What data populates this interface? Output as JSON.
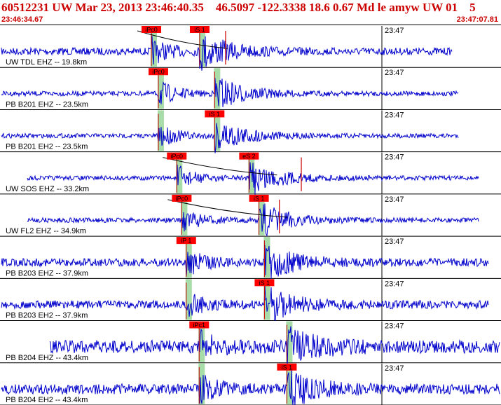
{
  "header": {
    "title": "60512231 UW Mar 23, 2013 23:46:40.35    46.5097 -122.3338 18.6 0.67 Md le amyw UW 01    5",
    "start_time": "23:46:34.67",
    "end_time": "23:47:07.81"
  },
  "time_tick_label": "23:47",
  "colors": {
    "trace": "#0000cc",
    "pick": "#ff0000",
    "window": "#a8dca8",
    "header_text": "#cc0000",
    "theoretical": "#000000"
  },
  "traces": [
    {
      "label": "UW TDL EHZ -- 19.8km",
      "signal_start": 0.0,
      "signal_end": 0.905,
      "noise": 0.3,
      "picks": [
        {
          "label": "iPc0",
          "t": 0.301
        },
        {
          "label": "iS 1",
          "t": 0.398
        }
      ],
      "windows": [
        0.301,
        0.398
      ],
      "arrivals": [
        0.301,
        0.398
      ],
      "curve": true,
      "spike": 0.45
    },
    {
      "label": "PB B201 EHZ -- 23.5km",
      "signal_start": 0.0,
      "signal_end": 0.918,
      "noise": 0.1,
      "picks": [
        {
          "label": "iPc0",
          "t": 0.315
        }
      ],
      "windows": [
        0.315,
        0.428
      ],
      "arrivals": [
        0.315,
        0.428
      ],
      "curve": false,
      "spike": null
    },
    {
      "label": "PB B201 EH2 -- 23.5km",
      "signal_start": 0.0,
      "signal_end": 0.918,
      "noise": 0.08,
      "picks": [
        {
          "label": "iS 1",
          "t": 0.428
        }
      ],
      "windows": [
        0.315,
        0.428
      ],
      "arrivals": [
        0.315,
        0.428
      ],
      "curve": false,
      "spike": null
    },
    {
      "label": "UW SOS EHZ -- 33.2km",
      "signal_start": 0.052,
      "signal_end": 0.958,
      "noise": 0.08,
      "picks": [
        {
          "label": "iPc0",
          "t": 0.352
        },
        {
          "label": "eS 2",
          "t": 0.497
        }
      ],
      "windows": [
        0.352,
        0.497
      ],
      "arrivals": [
        0.352,
        0.497
      ],
      "curve": true,
      "spike": 0.602
    },
    {
      "label": "UW FL2 EHZ -- 34.9km",
      "signal_start": 0.052,
      "signal_end": 0.958,
      "noise": 0.1,
      "picks": [
        {
          "label": "iPc0",
          "t": 0.362
        },
        {
          "label": "iS 1",
          "t": 0.517
        }
      ],
      "windows": [
        0.362,
        0.517
      ],
      "arrivals": [
        0.362,
        0.517
      ],
      "curve": true,
      "spike": 0.558
    },
    {
      "label": "PB B203 EHZ -- 37.9km",
      "signal_start": 0.0,
      "signal_end": 0.978,
      "noise": 0.35,
      "picks": [
        {
          "label": "iP 1",
          "t": 0.371
        }
      ],
      "windows": [
        0.371,
        0.528
      ],
      "arrivals": [
        0.371,
        0.528
      ],
      "curve": false,
      "spike": null
    },
    {
      "label": "PB B203 EH2 -- 37.9km",
      "signal_start": 0.0,
      "signal_end": 0.978,
      "noise": 0.35,
      "picks": [
        {
          "label": "iS 1",
          "t": 0.528
        }
      ],
      "windows": [
        0.371,
        0.528
      ],
      "arrivals": [
        0.371,
        0.528
      ],
      "curve": false,
      "spike": null
    },
    {
      "label": "PB B204 EHZ -- 43.4km",
      "signal_start": 0.097,
      "signal_end": 1.0,
      "noise": 0.75,
      "picks": [
        {
          "label": "iPc1",
          "t": 0.397
        }
      ],
      "windows": [
        0.397,
        0.573
      ],
      "arrivals": [
        0.397,
        0.573
      ],
      "curve": false,
      "spike": null
    },
    {
      "label": "PB B204 EH2 -- 43.4km",
      "signal_start": 0.0,
      "signal_end": 1.0,
      "noise": 0.55,
      "picks": [
        {
          "label": "iS 1",
          "t": 0.573
        }
      ],
      "windows": [
        0.397,
        0.573
      ],
      "arrivals": [
        0.397,
        0.573
      ],
      "curve": false,
      "spike": null
    }
  ]
}
